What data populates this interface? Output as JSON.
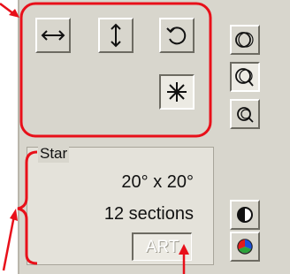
{
  "toolbar": {
    "tools": [
      {
        "icon": "horizontal-double-arrow-icon",
        "selected": false
      },
      {
        "icon": "vertical-double-arrow-icon",
        "selected": false
      },
      {
        "icon": "rotate-icon",
        "selected": false
      },
      {
        "icon": "star-icon",
        "selected": true
      }
    ]
  },
  "side_buttons": [
    {
      "icon": "view-circle-outline-icon",
      "selected": false
    },
    {
      "icon": "view-circle-pointer-icon",
      "selected": true
    },
    {
      "icon": "view-circle-small-pointer-icon",
      "selected": false
    },
    {
      "icon": "contrast-icon",
      "selected": false
    },
    {
      "icon": "color-wheel-icon",
      "selected": false
    }
  ],
  "info_panel": {
    "title": "Star",
    "size": "20° x 20°",
    "sections": "12 sections",
    "art_label": "ART"
  },
  "colors": {
    "highlight": "#e8101a",
    "panel": "#d8d6cd"
  }
}
